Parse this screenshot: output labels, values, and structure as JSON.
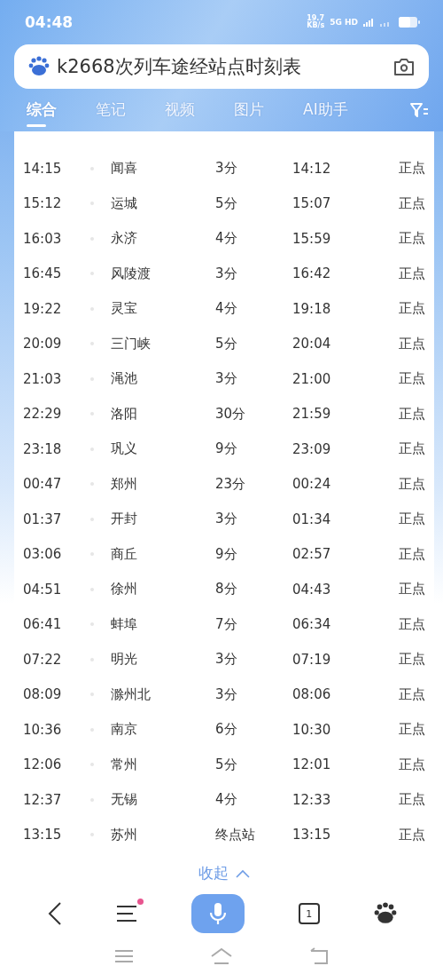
{
  "status_bar": {
    "time": "04:48",
    "speed": "19.7",
    "speed_unit": "KB/s",
    "network": "5G HD"
  },
  "search": {
    "value": "k2668次列车途经站点时刻表"
  },
  "tabs": [
    {
      "label": "综合",
      "selected": true
    },
    {
      "label": "笔记",
      "selected": false
    },
    {
      "label": "视频",
      "selected": false
    },
    {
      "label": "图片",
      "selected": false
    },
    {
      "label": "AI助手",
      "selected": false
    }
  ],
  "table": {
    "rows": [
      [
        "14:15",
        "闻喜",
        "3分",
        "14:12",
        "正点"
      ],
      [
        "15:12",
        "运城",
        "5分",
        "15:07",
        "正点"
      ],
      [
        "16:03",
        "永济",
        "4分",
        "15:59",
        "正点"
      ],
      [
        "16:45",
        "风陵渡",
        "3分",
        "16:42",
        "正点"
      ],
      [
        "19:22",
        "灵宝",
        "4分",
        "19:18",
        "正点"
      ],
      [
        "20:09",
        "三门峡",
        "5分",
        "20:04",
        "正点"
      ],
      [
        "21:03",
        "渑池",
        "3分",
        "21:00",
        "正点"
      ],
      [
        "22:29",
        "洛阳",
        "30分",
        "21:59",
        "正点"
      ],
      [
        "23:18",
        "巩义",
        "9分",
        "23:09",
        "正点"
      ],
      [
        "00:47",
        "郑州",
        "23分",
        "00:24",
        "正点"
      ],
      [
        "01:37",
        "开封",
        "3分",
        "01:34",
        "正点"
      ],
      [
        "03:06",
        "商丘",
        "9分",
        "02:57",
        "正点"
      ],
      [
        "04:51",
        "徐州",
        "8分",
        "04:43",
        "正点"
      ],
      [
        "06:41",
        "蚌埠",
        "7分",
        "06:34",
        "正点"
      ],
      [
        "07:22",
        "明光",
        "3分",
        "07:19",
        "正点"
      ],
      [
        "08:09",
        "滁州北",
        "3分",
        "08:06",
        "正点"
      ],
      [
        "10:36",
        "南京",
        "6分",
        "10:30",
        "正点"
      ],
      [
        "12:06",
        "常州",
        "5分",
        "12:01",
        "正点"
      ],
      [
        "12:37",
        "无锡",
        "4分",
        "12:33",
        "正点"
      ],
      [
        "13:15",
        "苏州",
        "终点站",
        "13:15",
        "正点"
      ]
    ]
  },
  "collapse": {
    "label": "收起"
  },
  "bottom_nav": {
    "menu_badge": true,
    "tab_count": "1"
  }
}
